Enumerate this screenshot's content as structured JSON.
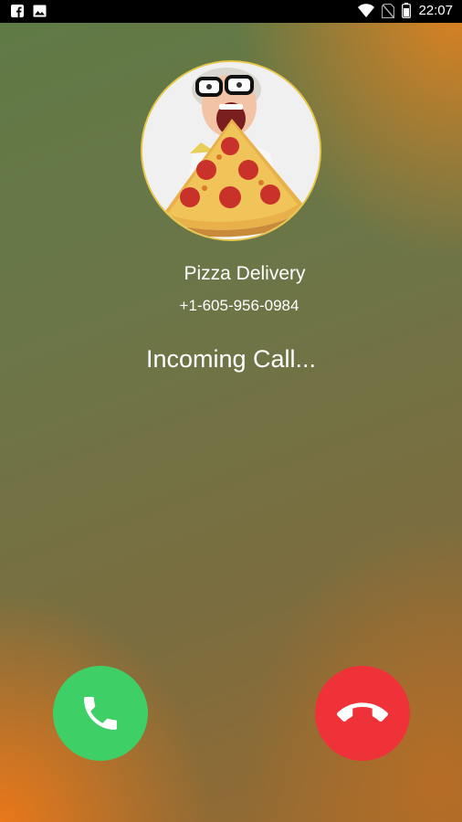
{
  "status_bar": {
    "time": "22:07",
    "left_icons": [
      "facebook-icon",
      "gallery-icon"
    ],
    "right_icons": [
      "wifi-icon",
      "no-sim-icon",
      "battery-icon"
    ]
  },
  "caller": {
    "name": "Pizza Delivery",
    "number": "+1-605-956-0984",
    "avatar_icon": "caller-photo-pizza"
  },
  "call": {
    "status": "Incoming Call..."
  },
  "actions": {
    "answer": {
      "icon": "phone-icon",
      "color": "#3ed067"
    },
    "decline": {
      "icon": "phone-hangup-icon",
      "color": "#ef3238"
    }
  }
}
